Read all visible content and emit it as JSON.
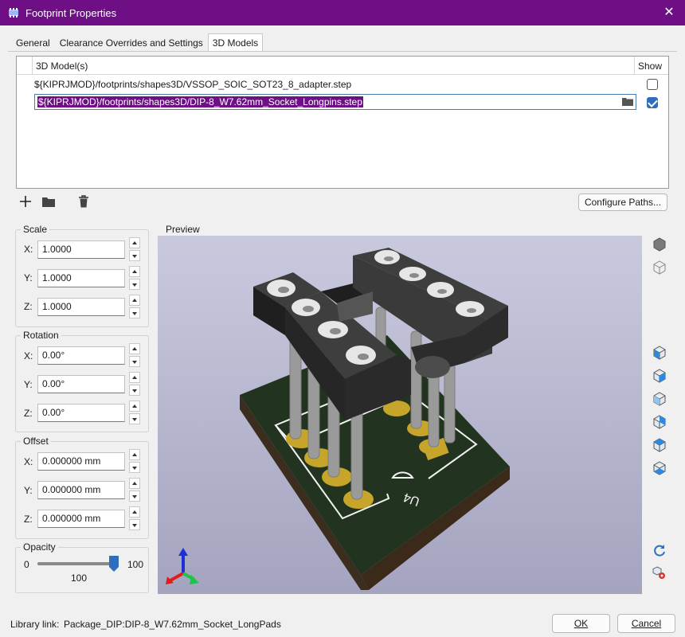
{
  "window": {
    "title": "Footprint Properties"
  },
  "tabs": [
    {
      "label": "General"
    },
    {
      "label": "Clearance Overrides and Settings"
    },
    {
      "label": "3D Models"
    }
  ],
  "models_table": {
    "col_model": "3D Model(s)",
    "col_show": "Show",
    "rows": [
      {
        "path": "${KIPRJMOD}/footprints/shapes3D/VSSOP_SOIC_SOT23_8_adapter.step",
        "show": false
      },
      {
        "path": "${KIPRJMOD}/footprints/shapes3D/DIP-8_W7.62mm_Socket_Longpins.step",
        "show": true
      }
    ]
  },
  "configure_paths_label": "Configure Paths...",
  "scale": {
    "label": "Scale",
    "x_label": "X:",
    "y_label": "Y:",
    "z_label": "Z:",
    "x": "1.0000",
    "y": "1.0000",
    "z": "1.0000"
  },
  "rotation": {
    "label": "Rotation",
    "x_label": "X:",
    "y_label": "Y:",
    "z_label": "Z:",
    "x": "0.00°",
    "y": "0.00°",
    "z": "0.00°"
  },
  "offset": {
    "label": "Offset",
    "x_label": "X:",
    "y_label": "Y:",
    "z_label": "Z:",
    "x": "0.000000 mm",
    "y": "0.000000 mm",
    "z": "0.000000 mm"
  },
  "opacity": {
    "label": "Opacity",
    "min": "0",
    "max": "100",
    "value": "100",
    "level": 1.0
  },
  "preview": {
    "label": "Preview",
    "silkscreen_ref": "U4"
  },
  "footer": {
    "library_link_label": "Library link:",
    "library_link_value": "Package_DIP:DIP-8_W7.62mm_Socket_LongPads",
    "ok_label": "OK",
    "cancel_label": "Cancel"
  },
  "colors": {
    "title_bar": "#6e0f86",
    "selection": "#6e0f86",
    "checkbox": "#2d6fbd",
    "pcb": "#22341f",
    "pad": "#c6a52a",
    "socket": "#2f2f2f"
  },
  "icons": {
    "toolbar": [
      "add-icon",
      "folder-icon",
      "delete-icon"
    ],
    "view": [
      "view-3d-solid-icon",
      "view-3d-wire-icon",
      "view-left-icon",
      "view-right-icon",
      "view-front-icon",
      "view-back-icon",
      "view-top-icon",
      "view-bottom-icon",
      "reload-icon",
      "settings-icon"
    ]
  }
}
